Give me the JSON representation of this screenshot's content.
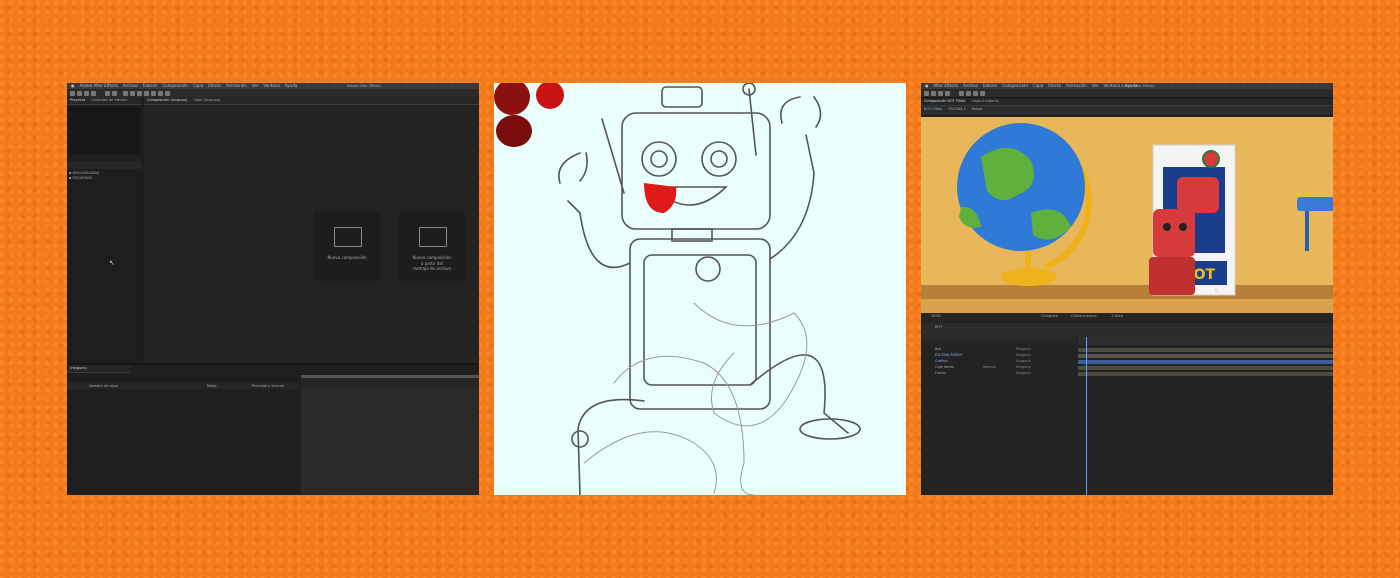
{
  "panel1": {
    "menu": [
      "Adobe After Effects",
      "Archivo",
      "Edición",
      "Composición",
      "Capa",
      "Efecto",
      "Animación",
      "Ver",
      "Ventana",
      "Ayuda"
    ],
    "window_title": "Adobe After Effects",
    "tabs_left": [
      "Proyecto",
      "Controles de efectos"
    ],
    "tabs_viewer": [
      "Composición (ninguno)",
      "Capa (ninguno)"
    ],
    "project_items": [
      "DESCARGADAS",
      "ESQUEMAS"
    ],
    "cards": [
      {
        "label": "Nueva composición"
      },
      {
        "label": "Nueva composición\na partir del\nmetraje de archivo"
      }
    ],
    "timeline_tab": "(ninguno)",
    "timeline_cols": [
      "Nombre de capa",
      "Modo",
      "Principal y vínculo"
    ]
  },
  "panel3": {
    "menu": [
      "After Effects",
      "Archivo",
      "Edición",
      "Composición",
      "Capa",
      "Efecto",
      "Animación",
      "Ver",
      "Ventana",
      "Ayuda"
    ],
    "window_title": "Adobe After Effects",
    "tabs_viewer": [
      "Composición ROT FINAL",
      "Capa (ninguno)"
    ],
    "subtabs": [
      "ROT FINAL",
      "ESCENA 1",
      "Robot"
    ],
    "box_label": "ROT",
    "zoom": "100%",
    "render_label": "Completa",
    "camera_label": "Cámara activa",
    "views_label": "1 vista",
    "timeline_tab": "ROT",
    "layers": [
      {
        "name": "Bot",
        "mode": "Normal",
        "parent": "Ninguno"
      },
      {
        "name": "ESCENA ROBOT",
        "mode": "Normal",
        "parent": "Ninguno"
      },
      {
        "name": "Gráfico",
        "mode": "Normal",
        "parent": "Ninguno"
      },
      {
        "name": "Caja fondo",
        "mode": "Normal",
        "parent": "Ninguno"
      },
      {
        "name": "Fondo",
        "mode": "Normal",
        "parent": "Ninguno"
      }
    ]
  },
  "colors": {
    "background": "#f47a1c",
    "ae_dark": "#232323",
    "paper": "#eafffd",
    "wall": "#e7b75a",
    "shelf": "#b77f3a",
    "robot_red": "#d63a3a",
    "box_blue": "#1b3e8c",
    "selection_blue": "#3b5f9c"
  }
}
